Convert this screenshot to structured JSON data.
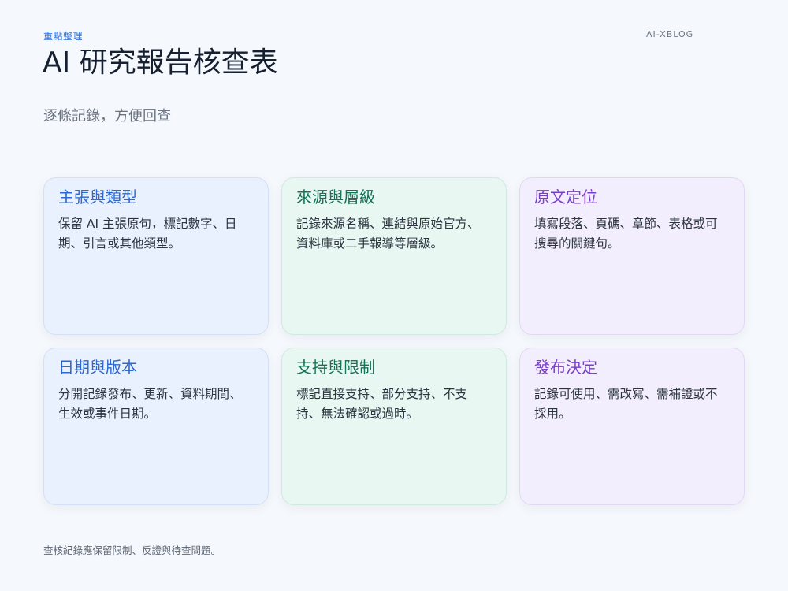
{
  "header": {
    "eyebrow": "重點整理",
    "brand": "AI-XBLOG",
    "title": "AI 研究報告核查表",
    "subtitle": "逐條記錄，方便回查"
  },
  "cards": [
    {
      "title": "主張與類型",
      "body": "保留 AI 主張原句，標記數字、日期、引言或其他類型。",
      "theme": "blue"
    },
    {
      "title": "來源與層級",
      "body": "記錄來源名稱、連結與原始官方、資料庫或二手報導等層級。",
      "theme": "green"
    },
    {
      "title": "原文定位",
      "body": "填寫段落、頁碼、章節、表格或可搜尋的關鍵句。",
      "theme": "purple"
    },
    {
      "title": "日期與版本",
      "body": "分開記錄發布、更新、資料期間、生效或事件日期。",
      "theme": "blue"
    },
    {
      "title": "支持與限制",
      "body": "標記直接支持、部分支持、不支持、無法確認或過時。",
      "theme": "green"
    },
    {
      "title": "發布決定",
      "body": "記錄可使用、需改寫、需補證或不採用。",
      "theme": "purple"
    }
  ],
  "footer": {
    "note": "查核紀錄應保留限制、反證與待查問題。"
  },
  "colors": {
    "background": "#f5f8fc",
    "accent_blue": "#2d67cf",
    "accent_green": "#147257",
    "accent_purple": "#7a3fc8"
  }
}
